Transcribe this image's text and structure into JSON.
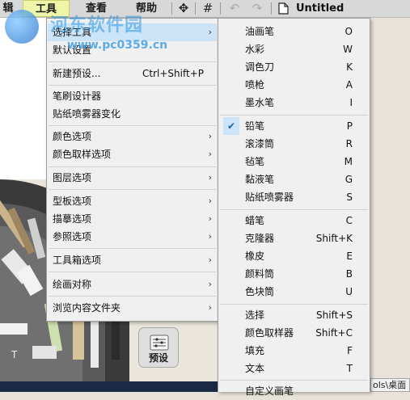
{
  "menubar": {
    "items": [
      {
        "label": "辑",
        "active": false
      },
      {
        "label": "工具",
        "active": true
      },
      {
        "label": "查看",
        "active": false
      },
      {
        "label": "帮助",
        "active": false
      }
    ],
    "document_title": "Untitled"
  },
  "tools_menu": {
    "items": [
      {
        "label": "选择工具",
        "shortcut": "",
        "submenu": true,
        "highlighted": true
      },
      {
        "label": "默认设置",
        "shortcut": "",
        "submenu": false
      },
      {
        "label": "新建预设...",
        "shortcut": "Ctrl+Shift+P",
        "submenu": false
      },
      {
        "label": "笔刷设计器",
        "shortcut": "",
        "submenu": false
      },
      {
        "label": "贴纸喷雾器变化",
        "shortcut": "",
        "submenu": false
      },
      {
        "label": "颜色选项",
        "shortcut": "",
        "submenu": true
      },
      {
        "label": "颜色取样选项",
        "shortcut": "",
        "submenu": true
      },
      {
        "label": "图层选项",
        "shortcut": "",
        "submenu": true
      },
      {
        "label": "型板选项",
        "shortcut": "",
        "submenu": true
      },
      {
        "label": "描摹选项",
        "shortcut": "",
        "submenu": true
      },
      {
        "label": "参照选项",
        "shortcut": "",
        "submenu": true
      },
      {
        "label": "工具箱选项",
        "shortcut": "",
        "submenu": true
      },
      {
        "label": "绘画对称",
        "shortcut": "",
        "submenu": true
      },
      {
        "label": "浏览内容文件夹",
        "shortcut": "",
        "submenu": true
      }
    ]
  },
  "select_tool_submenu": {
    "items": [
      {
        "label": "油画笔",
        "shortcut": "O"
      },
      {
        "label": "水彩",
        "shortcut": "W"
      },
      {
        "label": "调色刀",
        "shortcut": "K"
      },
      {
        "label": "喷枪",
        "shortcut": "A"
      },
      {
        "label": "墨水笔",
        "shortcut": "I"
      },
      {
        "label": "铅笔",
        "shortcut": "P",
        "checked": true
      },
      {
        "label": "滚漆筒",
        "shortcut": "R"
      },
      {
        "label": "毡笔",
        "shortcut": "M"
      },
      {
        "label": "黏液笔",
        "shortcut": "G"
      },
      {
        "label": "贴纸喷雾器",
        "shortcut": "S"
      },
      {
        "label": "蜡笔",
        "shortcut": "C"
      },
      {
        "label": "克隆器",
        "shortcut": "Shift+K"
      },
      {
        "label": "橡皮",
        "shortcut": "E"
      },
      {
        "label": "颜料筒",
        "shortcut": "B"
      },
      {
        "label": "色块筒",
        "shortcut": "U"
      },
      {
        "label": "选择",
        "shortcut": "Shift+S"
      },
      {
        "label": "颜色取样器",
        "shortcut": "Shift+C"
      },
      {
        "label": "填充",
        "shortcut": "F"
      },
      {
        "label": "文本",
        "shortcut": "T"
      },
      {
        "label": "自定义画笔",
        "shortcut": ""
      }
    ]
  },
  "toolbox": {
    "preset_label": "预设",
    "tool_letter": "T"
  },
  "taskbar": {
    "path_text": "ols\\桌面"
  },
  "watermark": {
    "site_name": "河东软件园",
    "url": "www.pc0359.cn"
  },
  "icons": [
    "move-icon",
    "grid-icon",
    "undo-icon",
    "redo-icon",
    "document-icon",
    "checkmark-icon",
    "submenu-arrow-icon"
  ],
  "colors": {
    "highlight": "#cce4f7",
    "menubar_active": "#eef5a8",
    "check": "#1f5fa8"
  }
}
